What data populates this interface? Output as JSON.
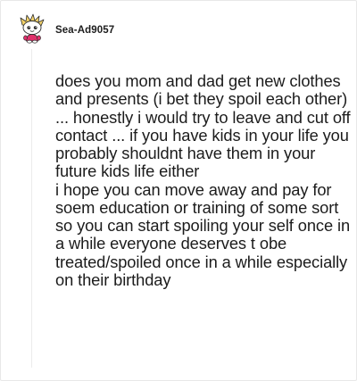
{
  "comment": {
    "author": "Sea-Ad9057",
    "avatar_icon": "snoo-avatar-icon",
    "paragraphs": [
      "does you mom and dad get new clothes and presents (i bet they spoil each other) ... honestly i would try to leave and cut off contact ... if you have kids in your life you probably shouldnt have them in your future kids life either",
      "i hope you can move away and pay for soem education or training of some sort so you can start spoiling your self once in a while everyone deserves t obe treated/spoiled once in a while especially on their birthday"
    ]
  },
  "colors": {
    "text": "#1c1c1c",
    "avatar_accent": "#e0306b",
    "avatar_hair": "#f3d36a",
    "thread_line": "#ececec"
  }
}
